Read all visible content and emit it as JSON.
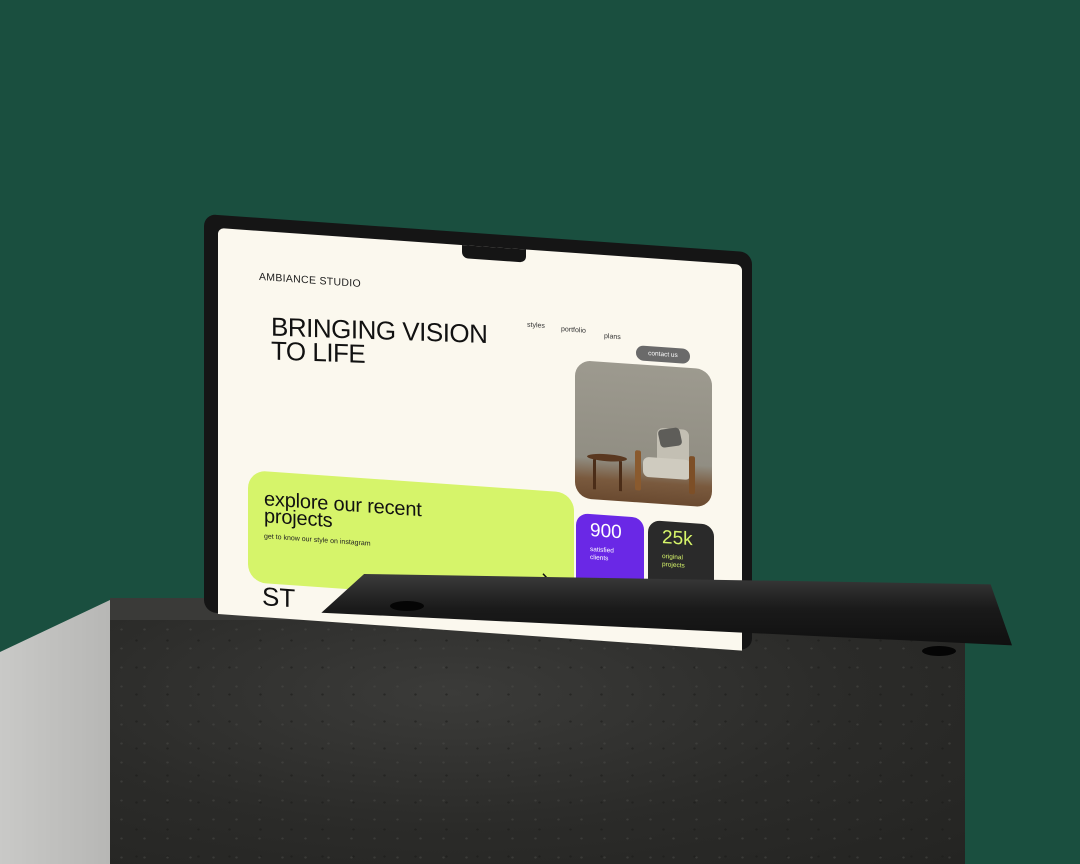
{
  "site": {
    "brand": "AMBIANCE STUDIO",
    "nav": [
      "styles",
      "portfolio",
      "plans"
    ],
    "contact_label": "contact us",
    "hero_line1": "BRINGING VISION",
    "hero_line2": "TO LIFE",
    "promo_line1": "explore our recent",
    "promo_line2": "projects",
    "promo_sub": "get to know our style on instagram",
    "stats": [
      {
        "value": "900",
        "label_line1": "satisfied",
        "label_line2": "clients"
      },
      {
        "value": "25k",
        "label_line1": "original",
        "label_line2": "projects"
      }
    ],
    "peek_text": "ST"
  },
  "colors": {
    "background": "#1a4f3f",
    "page": "#fbf8ee",
    "lime": "#d6f46a",
    "purple": "#6a28e6",
    "dark_card": "#2a2a2a",
    "button": "#6a6a6a"
  },
  "icons": [
    "arrow-down-right-icon"
  ]
}
